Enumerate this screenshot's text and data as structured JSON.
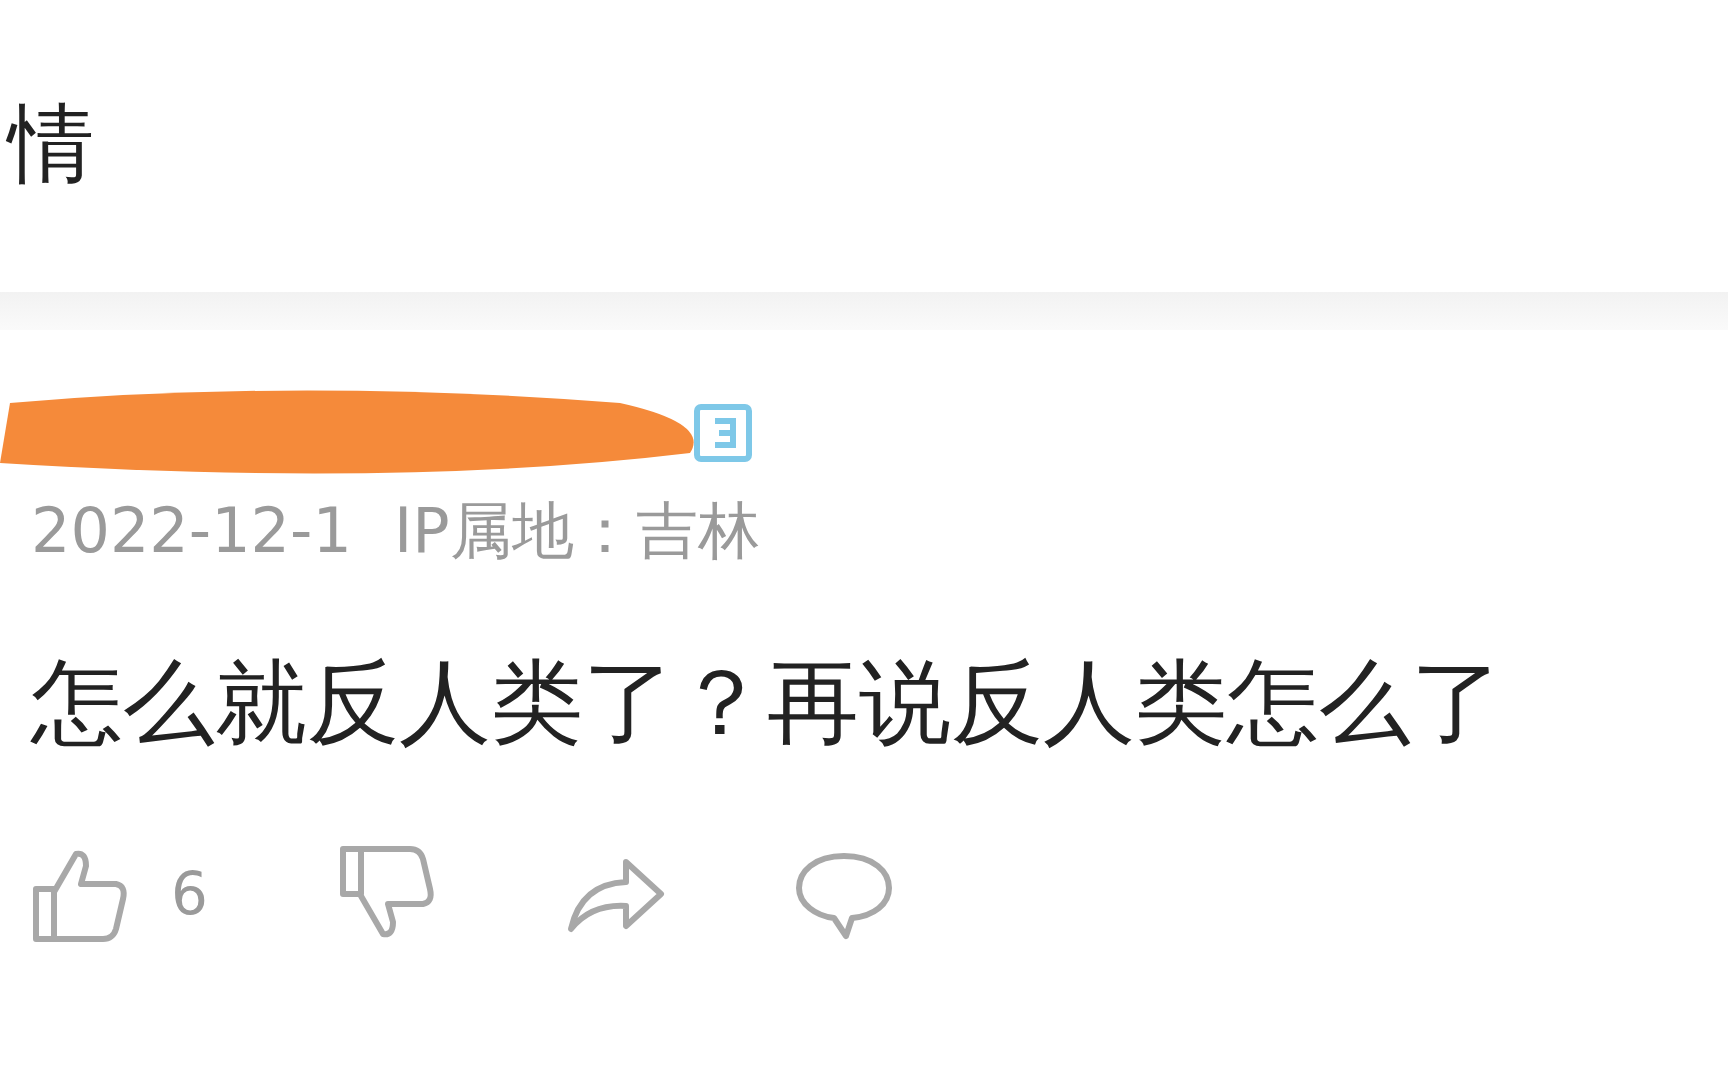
{
  "header": {
    "title": "情"
  },
  "comment": {
    "date": "2022-12-1",
    "ip_location": "IP属地：吉林",
    "text": "怎么就反人类了？再说反人类怎么了",
    "like_count": "6"
  }
}
